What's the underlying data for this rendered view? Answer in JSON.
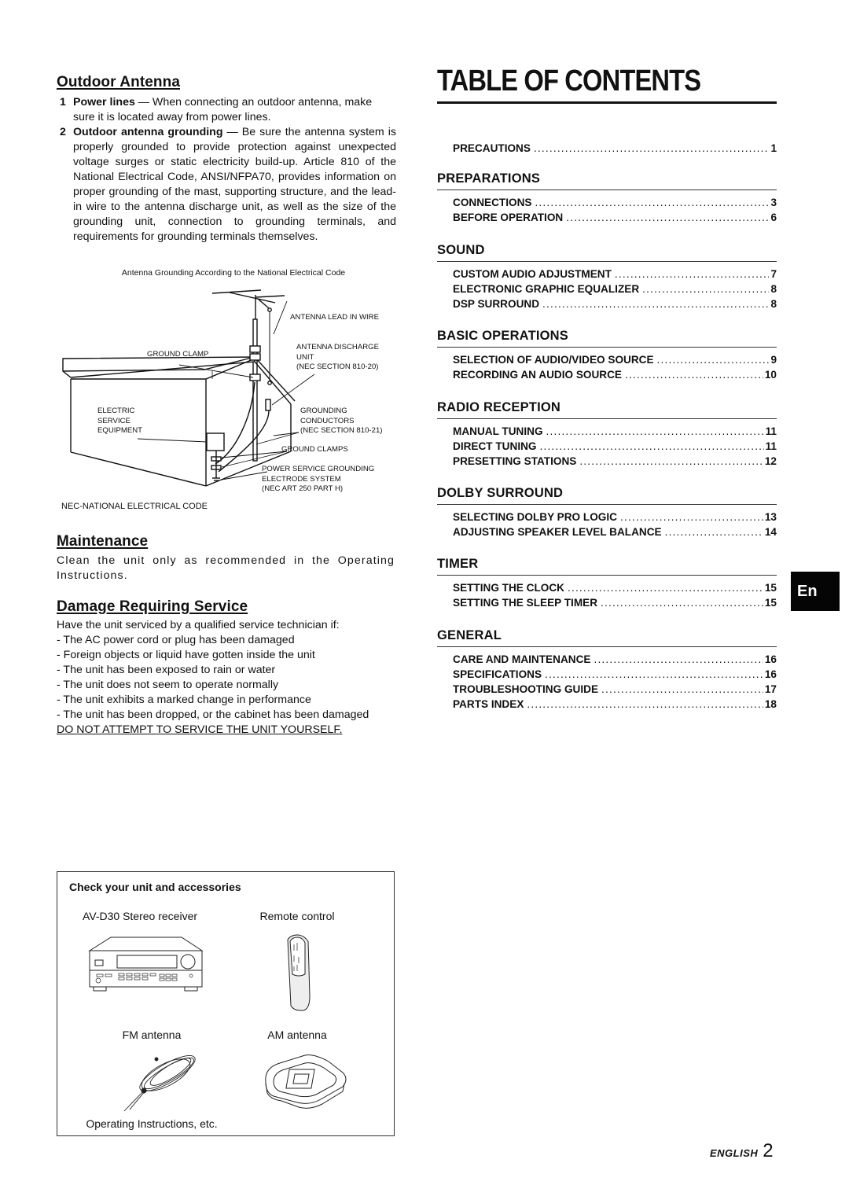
{
  "outdoor_antenna": {
    "heading": "Outdoor Antenna",
    "items": [
      {
        "num": "1",
        "title": "Power lines",
        "text": " — When connecting an outdoor antenna, make sure it is located away from power lines."
      },
      {
        "num": "2",
        "title": "Outdoor antenna grounding",
        "text": " — Be sure the antenna system is properly grounded to provide protection against unexpected voltage surges or static electricity build-up.  Article 810 of the National Electrical Code, ANSI/NFPA70, provides information on proper grounding of the mast, supporting structure, and the lead-in wire to the antenna discharge unit, as well as the size of the grounding unit, connection to grounding terminals, and requirements for grounding terminals themselves."
      }
    ]
  },
  "diagram": {
    "caption": "Antenna Grounding According to the National Electrical Code",
    "labels": {
      "lead_in": "ANTENNA LEAD IN WIRE",
      "ground_clamp": "GROUND CLAMP",
      "discharge_1": "ANTENNA DISCHARGE",
      "discharge_2": "UNIT",
      "discharge_3": "(NEC SECTION 810-20)",
      "electric_1": "ELECTRIC",
      "electric_2": "SERVICE",
      "electric_3": "EQUIPMENT",
      "conductors_1": "GROUNDING",
      "conductors_2": "CONDUCTORS",
      "conductors_3": "(NEC SECTION 810-21)",
      "ground_clamps": "GROUND CLAMPS",
      "electrode_1": "POWER SERVICE GROUNDING",
      "electrode_2": "ELECTRODE SYSTEM",
      "electrode_3": "(NEC ART 250 PART H)"
    },
    "note": "NEC-NATIONAL ELECTRICAL CODE"
  },
  "maintenance": {
    "heading": "Maintenance",
    "text": "Clean the unit only as recommended in the Operating Instructions."
  },
  "damage": {
    "heading": "Damage Requiring Service",
    "intro": "Have the unit serviced by a qualified service technician if:",
    "items": [
      "- The AC power cord or plug has been damaged",
      "- Foreign objects or liquid have gotten inside the unit",
      "- The unit has been exposed to rain or water",
      "- The unit does not seem to operate normally",
      "- The unit exhibits a marked change in performance",
      "- The unit has been dropped, or the cabinet has been damaged"
    ],
    "warning": "DO NOT ATTEMPT TO SERVICE THE UNIT YOURSELF."
  },
  "accessories": {
    "title": "Check your unit and accessories",
    "items": [
      {
        "label": "AV-D30 Stereo receiver",
        "icon": "stereo-receiver-icon"
      },
      {
        "label": "Remote control",
        "icon": "remote-control-icon"
      },
      {
        "label": "FM antenna",
        "icon": "fm-antenna-icon"
      },
      {
        "label": "AM antenna",
        "icon": "am-antenna-icon"
      }
    ],
    "footer": "Operating Instructions, etc."
  },
  "toc": {
    "title": "TABLE OF CONTENTS",
    "top_entry": {
      "label": "PRECAUTIONS",
      "page": "1"
    },
    "sections": [
      {
        "heading": "PREPARATIONS",
        "entries": [
          {
            "label": "CONNECTIONS",
            "page": "3"
          },
          {
            "label": "BEFORE OPERATION",
            "page": "6"
          }
        ]
      },
      {
        "heading": "SOUND",
        "entries": [
          {
            "label": "CUSTOM AUDIO ADJUSTMENT",
            "page": "7"
          },
          {
            "label": "ELECTRONIC GRAPHIC EQUALIZER",
            "page": "8"
          },
          {
            "label": "DSP SURROUND",
            "page": "8"
          }
        ]
      },
      {
        "heading": "BASIC OPERATIONS",
        "entries": [
          {
            "label": "SELECTION OF AUDIO/VIDEO SOURCE",
            "page": "9"
          },
          {
            "label": "RECORDING AN AUDIO SOURCE",
            "page": "10"
          }
        ]
      },
      {
        "heading": "RADIO RECEPTION",
        "entries": [
          {
            "label": "MANUAL TUNING",
            "page": "11"
          },
          {
            "label": "DIRECT TUNING",
            "page": "11"
          },
          {
            "label": "PRESETTING STATIONS",
            "page": "12"
          }
        ]
      },
      {
        "heading": "DOLBY SURROUND",
        "entries": [
          {
            "label": "SELECTING DOLBY PRO LOGIC",
            "page": "13"
          },
          {
            "label": "ADJUSTING SPEAKER LEVEL BALANCE",
            "page": "14"
          }
        ]
      },
      {
        "heading": "TIMER",
        "entries": [
          {
            "label": "SETTING THE CLOCK",
            "page": "15"
          },
          {
            "label": "SETTING THE SLEEP TIMER",
            "page": "15"
          }
        ]
      },
      {
        "heading": "GENERAL",
        "entries": [
          {
            "label": "CARE AND MAINTENANCE",
            "page": "16"
          },
          {
            "label": "SPECIFICATIONS",
            "page": "16"
          },
          {
            "label": "TROUBLESHOOTING GUIDE",
            "page": "17"
          },
          {
            "label": "PARTS INDEX",
            "page": "18"
          }
        ]
      }
    ]
  },
  "language_tab": "En",
  "footer": {
    "language": "ENGLISH",
    "page": "2"
  }
}
